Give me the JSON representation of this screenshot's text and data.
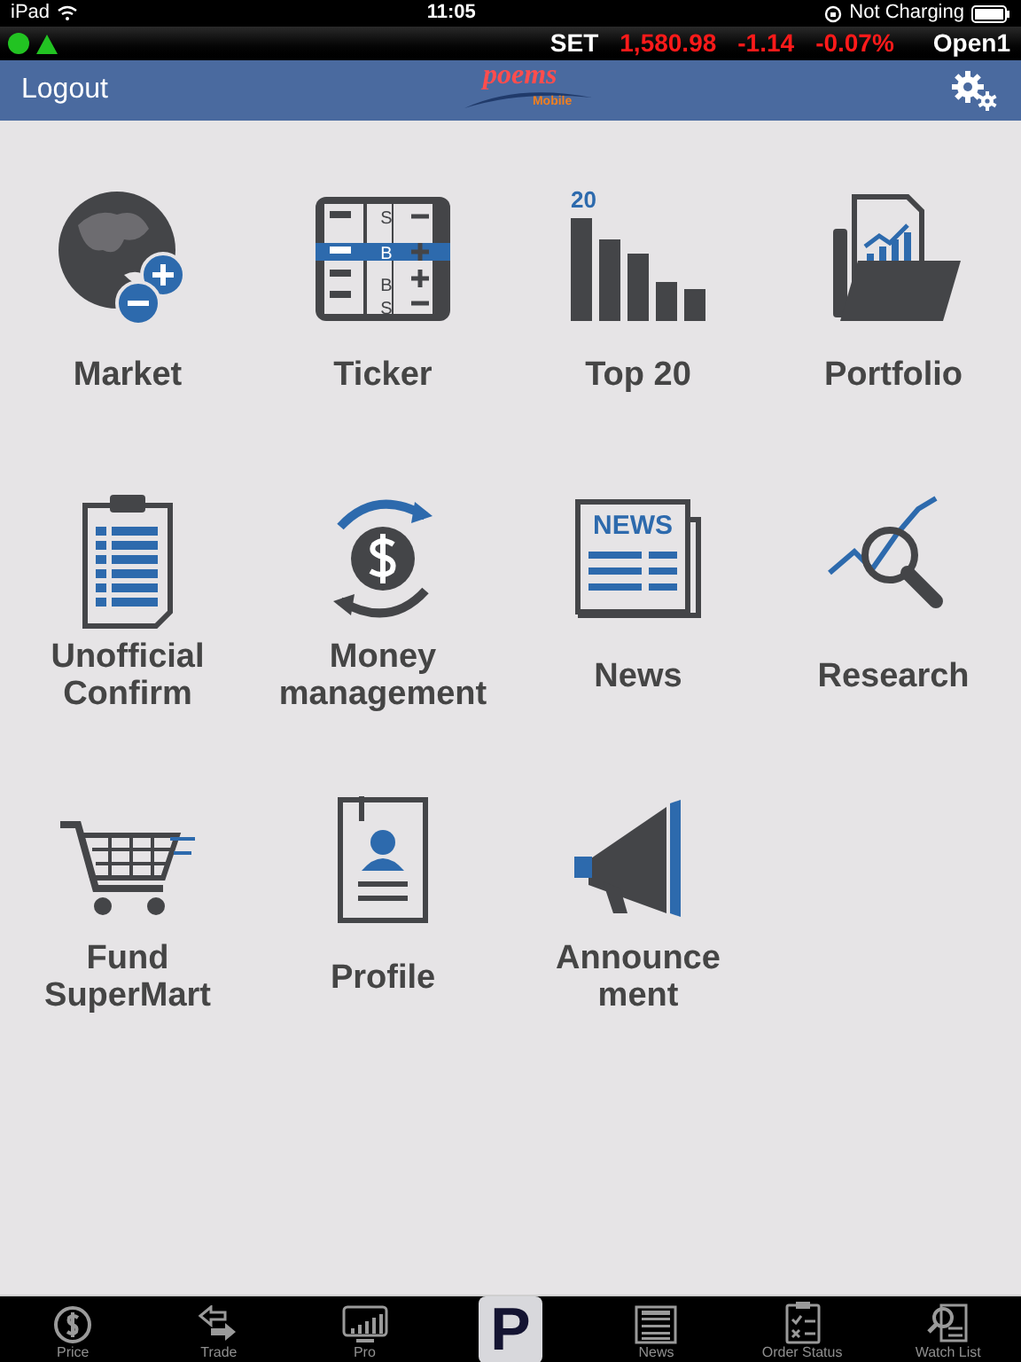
{
  "status_bar": {
    "device": "iPad",
    "time": "11:05",
    "battery_text": "Not Charging"
  },
  "ticker_bar": {
    "index": "SET",
    "value": "1,580.98",
    "change": "-1.14",
    "percent": "-0.07%",
    "session": "Open1"
  },
  "header": {
    "logout": "Logout",
    "logo": "poems",
    "logo_sub": "Mobile"
  },
  "tiles": [
    {
      "kind": "market",
      "label": "Market"
    },
    {
      "kind": "ticker",
      "label": "Ticker",
      "icon_text": [
        "S",
        "B",
        "B",
        "S"
      ]
    },
    {
      "kind": "top20",
      "label": "Top 20",
      "icon_text": [
        "20"
      ]
    },
    {
      "kind": "portfolio",
      "label": "Portfolio"
    },
    {
      "kind": "confirm",
      "label": "Unofficial Confirm"
    },
    {
      "kind": "money",
      "label": "Money management"
    },
    {
      "kind": "news",
      "label": "News",
      "icon_text": [
        "NEWS"
      ]
    },
    {
      "kind": "research",
      "label": "Research"
    },
    {
      "kind": "cart",
      "label": "Fund SuperMart"
    },
    {
      "kind": "profile",
      "label": "Profile"
    },
    {
      "kind": "announce",
      "label": "Announce ment"
    }
  ],
  "tabs": [
    {
      "kind": "price",
      "label": "Price"
    },
    {
      "kind": "trade",
      "label": "Trade"
    },
    {
      "kind": "pro",
      "label": "Pro"
    },
    {
      "kind": "logo",
      "label": "P"
    },
    {
      "kind": "news",
      "label": "News"
    },
    {
      "kind": "order",
      "label": "Order Status"
    },
    {
      "kind": "watch",
      "label": "Watch List"
    }
  ]
}
